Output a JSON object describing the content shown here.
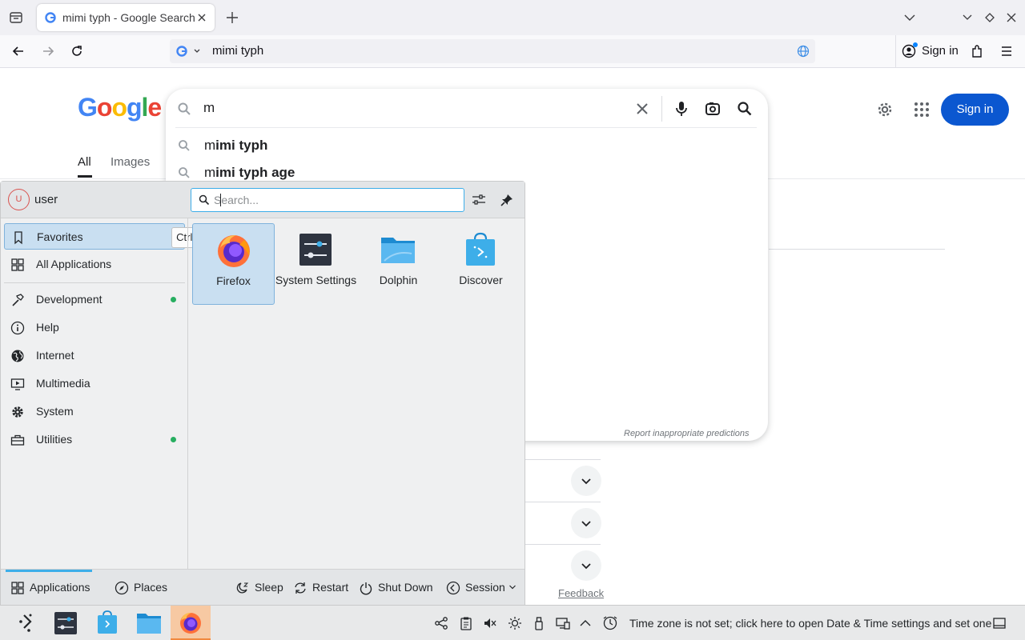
{
  "browser": {
    "tab_title": "mimi typh - Google Search",
    "url_text": "mimi typh",
    "sign_in_label": "Sign in"
  },
  "google": {
    "logo": "Google",
    "tabs": [
      {
        "label": "All"
      },
      {
        "label": "Images"
      }
    ],
    "search_query": "m",
    "suggestions": [
      {
        "prefix": "m",
        "rest": "imi typh"
      },
      {
        "prefix": "m",
        "rest": "imi typh age"
      }
    ],
    "report_text": "Report inappropriate predictions",
    "sign_in_label": "Sign in",
    "feedback_label": "Feedback"
  },
  "launcher": {
    "user_name": "user",
    "avatar_letter": "U",
    "search_placeholder": "Search...",
    "tooltip": "Ctrl+F",
    "categories": [
      {
        "label": "Favorites",
        "icon": "bookmark-icon",
        "selected": true
      },
      {
        "label": "All Applications",
        "icon": "grid-icon"
      },
      {
        "label": "Development",
        "icon": "hammer-icon",
        "new": true
      },
      {
        "label": "Help",
        "icon": "info-icon"
      },
      {
        "label": "Internet",
        "icon": "globe-icon"
      },
      {
        "label": "Multimedia",
        "icon": "monitor-play-icon"
      },
      {
        "label": "System",
        "icon": "gear-icon"
      },
      {
        "label": "Utilities",
        "icon": "toolbox-icon",
        "new": true
      }
    ],
    "apps": [
      {
        "label": "Firefox",
        "icon": "firefox-icon",
        "selected": true
      },
      {
        "label": "System Settings",
        "icon": "system-settings-icon"
      },
      {
        "label": "Dolphin",
        "icon": "folder-icon"
      },
      {
        "label": "Discover",
        "icon": "discover-bag-icon"
      }
    ],
    "footer": {
      "applications": "Applications",
      "places": "Places",
      "sleep": "Sleep",
      "restart": "Restart",
      "shut_down": "Shut Down",
      "session": "Session"
    }
  },
  "taskbar": {
    "timezone_text": "Time zone is not set; click here to open Date & Time settings and set one"
  },
  "colors": {
    "kde_accent": "#3daee9",
    "google_blue": "#0b57d0",
    "selection_bg": "#c9dff1",
    "new_dot": "#27ae60"
  }
}
